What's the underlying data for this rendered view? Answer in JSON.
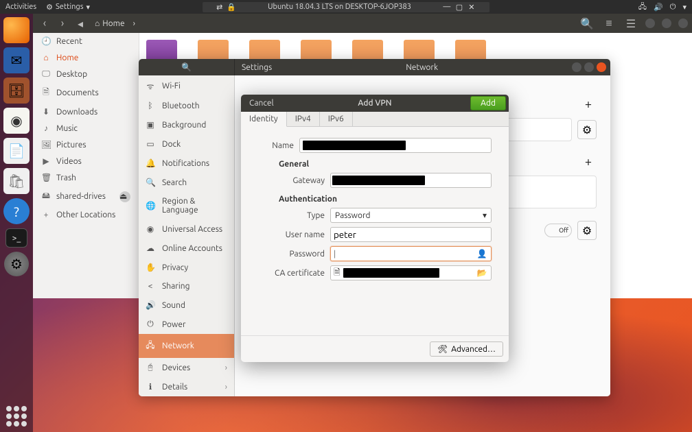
{
  "topbar": {
    "activities": "Activities",
    "settings_menu": "Settings",
    "window_title": "Ubuntu 18.04.3 LTS on DESKTOP-6JOP383"
  },
  "files": {
    "home_label": "Home",
    "sidebar": [
      {
        "icon": "🕘",
        "label": "Recent"
      },
      {
        "icon": "⌂",
        "label": "Home",
        "active": true
      },
      {
        "icon": "🖵",
        "label": "Desktop"
      },
      {
        "icon": "🗎",
        "label": "Documents"
      },
      {
        "icon": "⬇",
        "label": "Downloads"
      },
      {
        "icon": "♪",
        "label": "Music"
      },
      {
        "icon": "🖼",
        "label": "Pictures"
      },
      {
        "icon": "▶",
        "label": "Videos"
      },
      {
        "icon": "🗑",
        "label": "Trash"
      },
      {
        "icon": "🖴",
        "label": "shared-drives",
        "eject": true
      },
      {
        "icon": "+",
        "label": "Other Locations"
      }
    ]
  },
  "settings": {
    "app_title": "Settings",
    "page_title": "Network",
    "sidebar": [
      {
        "icon": "ᯤ",
        "label": "Wi-Fi"
      },
      {
        "icon": "ᛒ",
        "label": "Bluetooth"
      },
      {
        "icon": "▣",
        "label": "Background"
      },
      {
        "icon": "▭",
        "label": "Dock"
      },
      {
        "icon": "🔔",
        "label": "Notifications"
      },
      {
        "icon": "🔍",
        "label": "Search"
      },
      {
        "icon": "🌐",
        "label": "Region & Language"
      },
      {
        "icon": "◉",
        "label": "Universal Access"
      },
      {
        "icon": "☁",
        "label": "Online Accounts"
      },
      {
        "icon": "✋",
        "label": "Privacy"
      },
      {
        "icon": "<",
        "label": "Sharing"
      },
      {
        "icon": "🔊",
        "label": "Sound"
      },
      {
        "icon": "⏻",
        "label": "Power"
      },
      {
        "icon": "🖧",
        "label": "Network",
        "active": true
      },
      {
        "icon": "🖰",
        "label": "Devices",
        "chevron": true
      },
      {
        "icon": "ℹ",
        "label": "Details",
        "chevron": true
      }
    ],
    "toggle_off": "Off"
  },
  "vpn": {
    "cancel": "Cancel",
    "title": "Add VPN",
    "add": "Add",
    "tabs": [
      "Identity",
      "IPv4",
      "IPv6"
    ],
    "active_tab": 0,
    "name_label": "Name",
    "general_heading": "General",
    "gateway_label": "Gateway",
    "auth_heading": "Authentication",
    "type_label": "Type",
    "type_value": "Password",
    "username_label": "User name",
    "username_value": "peter",
    "password_label": "Password",
    "password_value": "",
    "cacert_label": "CA certificate",
    "advanced": "Advanced…"
  }
}
